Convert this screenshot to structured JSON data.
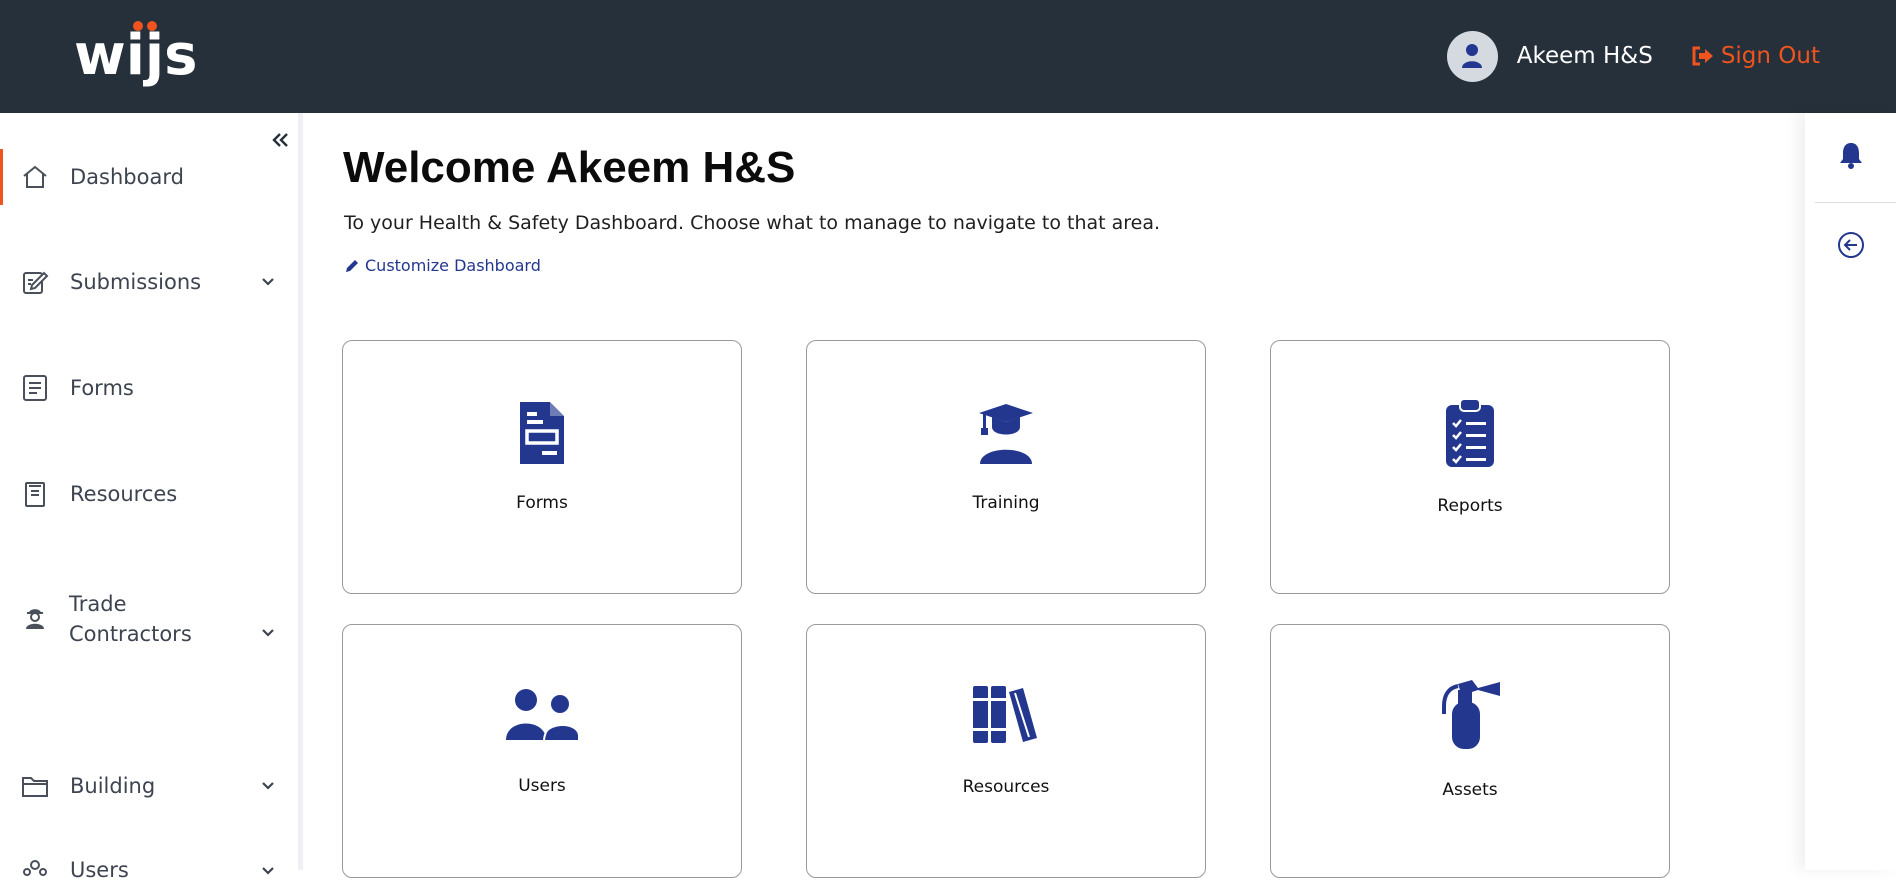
{
  "header": {
    "logo_text": "wijs",
    "user_name": "Akeem H&S",
    "signout_label": "Sign Out"
  },
  "colors": {
    "topbar": "#25303b",
    "accent": "#f0541e",
    "icon_blue": "#24378f"
  },
  "sidebar": {
    "items": [
      {
        "label": "Dashboard",
        "icon": "home-icon",
        "active": true
      },
      {
        "label": "Submissions",
        "icon": "edit-icon",
        "has_chevron": true
      },
      {
        "label": "Forms",
        "icon": "form-icon"
      },
      {
        "label": "Resources",
        "icon": "resource-icon"
      },
      {
        "label": "Trade",
        "label2": "Contractors",
        "icon": "worker-icon",
        "has_chevron": true
      },
      {
        "label": "Building",
        "icon": "folder-icon",
        "has_chevron": true
      },
      {
        "label": "Users",
        "icon": "users-icon",
        "has_chevron": true
      }
    ]
  },
  "main": {
    "welcome": "Welcome Akeem H&S",
    "subtitle": "To your Health & Safety Dashboard. Choose what to manage to navigate to that area.",
    "customize_label": "Customize Dashboard",
    "cards": [
      {
        "label": "Forms",
        "icon": "document-icon"
      },
      {
        "label": "Training",
        "icon": "graduate-icon"
      },
      {
        "label": "Reports",
        "icon": "clipboard-icon"
      },
      {
        "label": "Users",
        "icon": "users-icon"
      },
      {
        "label": "Resources",
        "icon": "books-icon"
      },
      {
        "label": "Assets",
        "icon": "fire-extinguisher-icon"
      }
    ]
  }
}
